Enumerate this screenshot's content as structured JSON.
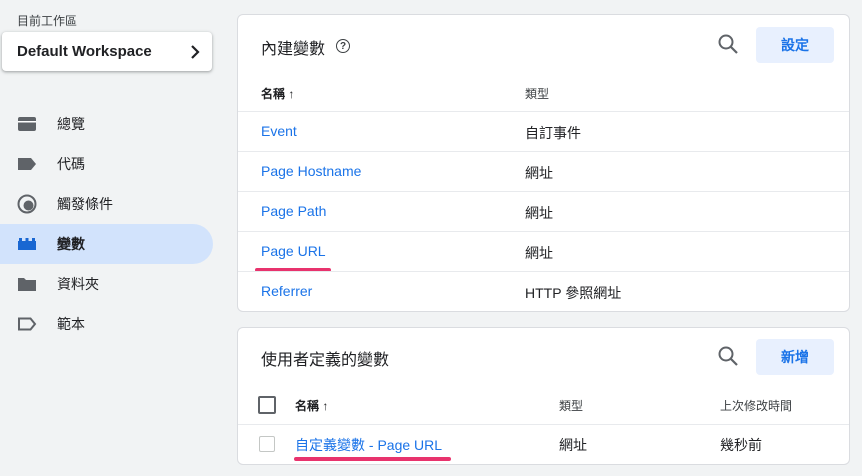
{
  "workspace": {
    "label": "目前工作區",
    "name": "Default Workspace"
  },
  "sidebar": {
    "items": [
      {
        "label": "總覽",
        "icon": "overview-icon"
      },
      {
        "label": "代碼",
        "icon": "tag-icon"
      },
      {
        "label": "觸發條件",
        "icon": "trigger-icon"
      },
      {
        "label": "變數",
        "icon": "variable-icon",
        "active": true
      },
      {
        "label": "資料夾",
        "icon": "folder-icon"
      },
      {
        "label": "範本",
        "icon": "template-icon"
      }
    ]
  },
  "builtin": {
    "title": "內建變數",
    "button": "設定",
    "col_name": "名稱",
    "col_type": "類型",
    "rows": [
      {
        "name": "Event",
        "type": "自訂事件"
      },
      {
        "name": "Page Hostname",
        "type": "網址"
      },
      {
        "name": "Page Path",
        "type": "網址"
      },
      {
        "name": "Page URL",
        "type": "網址"
      },
      {
        "name": "Referrer",
        "type": "HTTP 參照網址"
      }
    ]
  },
  "custom": {
    "title": "使用者定義的變數",
    "button": "新增",
    "col_name": "名稱",
    "col_type": "類型",
    "col_modified": "上次修改時間",
    "rows": [
      {
        "name": "自定義變數 - Page URL",
        "type": "網址",
        "modified": "幾秒前"
      }
    ]
  },
  "colors": {
    "accent": "#1a73e8",
    "active_bg": "#d2e3fc",
    "highlight": "#e8336d"
  }
}
